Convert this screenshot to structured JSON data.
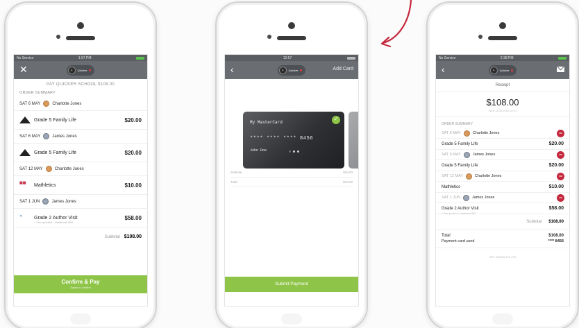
{
  "phone1": {
    "status": {
      "carrier": "No Service",
      "time": "1:57 PM"
    },
    "nav": {
      "close": "✕",
      "brand": "Quicker"
    },
    "title": "PAY QUICKER SCHOOL $108.00",
    "section": "ORDER SUMMARY",
    "groups": [
      {
        "date": "SAT 6 MAY",
        "child": "Charlotte Jones",
        "item": "Grade 5 Family Life",
        "price": "$20.00"
      },
      {
        "date": "SAT 6 MAY",
        "child": "James Jones",
        "item": "Grade 5 Family Life",
        "price": "$20.00"
      },
      {
        "date": "SAT 12 MAY",
        "child": "Charlotte Jones",
        "item": "Mathletics",
        "price": "$10.00"
      },
      {
        "date": "SAT 1 JUN",
        "child": "James Jones",
        "item": "Grade 2 Author Visit",
        "price": "$58.00",
        "note": "+ Free product · Instalment $40"
      }
    ],
    "subtotal_label": "Subtotal",
    "subtotal_value": "$108.00",
    "confirm_label": "Confirm & Pay",
    "confirm_sub": "Swipe to confirm"
  },
  "phone2": {
    "status": {
      "carrier": "",
      "time": "12:57"
    },
    "nav": {
      "back": "‹",
      "brand": "Quicker",
      "add": "Add Card"
    },
    "card": {
      "name": "My MasterCard",
      "number": "**** **** **** 8456",
      "holder": "John Doe"
    },
    "summary": [
      {
        "label": "Subtotal",
        "value": "$16.00"
      },
      {
        "label": "Total",
        "value": "$16.00"
      }
    ],
    "submit_label": "Submit Payment"
  },
  "phone3": {
    "status": {
      "carrier": "No Service",
      "time": "2:38 PM"
    },
    "nav": {
      "back": "‹",
      "brand": "Quicker"
    },
    "title": "Receipt",
    "amount": "$108.00",
    "date": "Wed 14.06.2016 10:21",
    "section": "ORDER SUMMARY",
    "groups": [
      {
        "date": "SAT 6 MAY",
        "child": "Charlotte Jones",
        "item": "Grade 5 Family Life",
        "price": "$20.00"
      },
      {
        "date": "SAT 6 MAY",
        "child": "James Jones",
        "item": "Grade 5 Family Life",
        "price": "$20.00"
      },
      {
        "date": "SAT 12 MAY",
        "child": "Charlotte Jones",
        "item": "Mathletics",
        "price": "$10.00"
      },
      {
        "date": "SAT 1 JUN",
        "child": "James Jones",
        "item": "Grade 2 Author Visit",
        "price": "$58.00",
        "note": "+ Free product · Instalment $40"
      }
    ],
    "subtotal_label": "Subtotal",
    "subtotal_value": "$108.00",
    "total_label": "Total",
    "total_value": "$108.00",
    "card_label": "Payment card used",
    "card_value": "**** 8456",
    "ref": "REF #05406-578-275"
  },
  "colors": {
    "accent": "#8ec549",
    "nav": "#6a6d72",
    "minus": "#c4283d",
    "arrow": "#c4283d"
  }
}
